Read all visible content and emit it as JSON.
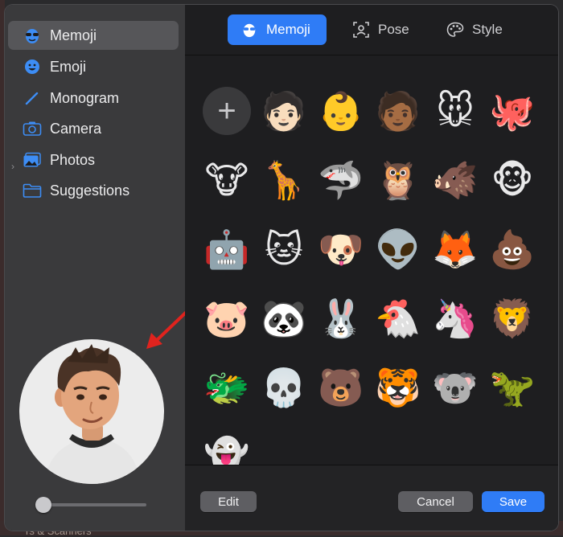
{
  "sidebar": {
    "items": [
      {
        "label": "Memoji",
        "icon": "memoji-icon",
        "active": true
      },
      {
        "label": "Emoji",
        "icon": "emoji-icon",
        "active": false
      },
      {
        "label": "Monogram",
        "icon": "pencil-icon",
        "active": false
      },
      {
        "label": "Camera",
        "icon": "camera-icon",
        "active": false
      },
      {
        "label": "Photos",
        "icon": "photos-icon",
        "active": false
      },
      {
        "label": "Suggestions",
        "icon": "folder-icon",
        "active": false
      }
    ],
    "preview": {
      "subject": "memoji-avatar"
    },
    "size_slider": {
      "value": 0.0
    }
  },
  "tabs": [
    {
      "label": "Memoji",
      "active": true,
      "icon": "memoji-tab-icon"
    },
    {
      "label": "Pose",
      "active": false,
      "icon": "pose-icon"
    },
    {
      "label": "Style",
      "active": false,
      "icon": "palette-icon"
    }
  ],
  "grid": {
    "add_label": "+",
    "items": [
      {
        "name": "memoji-boy-light",
        "glyph": "🧑🏻"
      },
      {
        "name": "memoji-bald",
        "glyph": "👶"
      },
      {
        "name": "memoji-boy-dark",
        "glyph": "🧑🏾"
      },
      {
        "name": "mouse",
        "glyph": "🐭"
      },
      {
        "name": "octopus",
        "glyph": "🐙"
      },
      {
        "name": "cow",
        "glyph": "🐮"
      },
      {
        "name": "giraffe",
        "glyph": "🦒"
      },
      {
        "name": "shark",
        "glyph": "🦈"
      },
      {
        "name": "owl",
        "glyph": "🦉"
      },
      {
        "name": "boar",
        "glyph": "🐗"
      },
      {
        "name": "monkey",
        "glyph": "🐵"
      },
      {
        "name": "robot",
        "glyph": "🤖"
      },
      {
        "name": "cat",
        "glyph": "🐱"
      },
      {
        "name": "dog",
        "glyph": "🐶"
      },
      {
        "name": "alien",
        "glyph": "👽"
      },
      {
        "name": "fox",
        "glyph": "🦊"
      },
      {
        "name": "poop",
        "glyph": "💩"
      },
      {
        "name": "pig",
        "glyph": "🐷"
      },
      {
        "name": "panda",
        "glyph": "🐼"
      },
      {
        "name": "rabbit",
        "glyph": "🐰"
      },
      {
        "name": "chicken",
        "glyph": "🐔"
      },
      {
        "name": "unicorn",
        "glyph": "🦄"
      },
      {
        "name": "lion",
        "glyph": "🦁"
      },
      {
        "name": "dragon",
        "glyph": "🐲"
      },
      {
        "name": "skull",
        "glyph": "💀"
      },
      {
        "name": "bear",
        "glyph": "🐻"
      },
      {
        "name": "tiger",
        "glyph": "🐯"
      },
      {
        "name": "koala",
        "glyph": "🐨"
      },
      {
        "name": "t-rex",
        "glyph": "🦖"
      },
      {
        "name": "ghost",
        "glyph": "👻"
      }
    ]
  },
  "footer": {
    "edit_label": "Edit",
    "cancel_label": "Cancel",
    "save_label": "Save"
  },
  "background_peek_text": "rs & Scanners",
  "colors": {
    "accent": "#2f7cf6",
    "annotation_arrow": "#e0231e"
  }
}
